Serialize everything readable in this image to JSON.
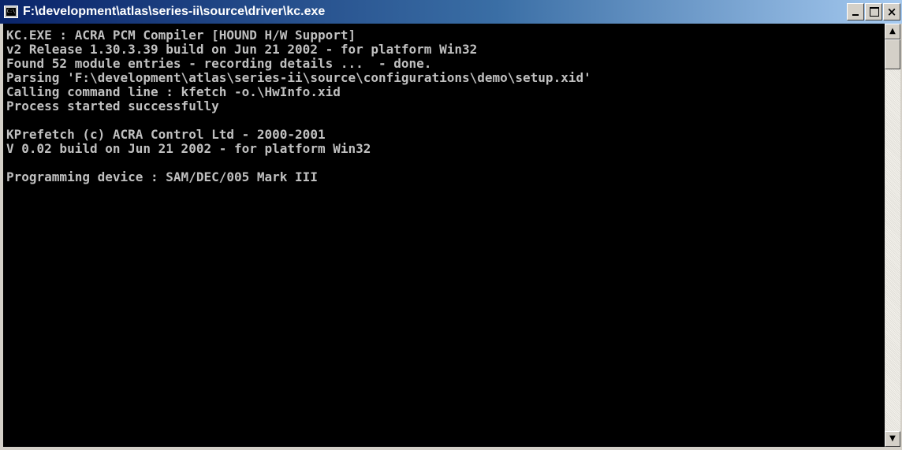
{
  "window": {
    "title": "F:\\development\\atlas\\series-ii\\source\\driver\\kc.exe",
    "icon": "console-app-icon",
    "icon_glyph": "C:\\",
    "buttons": {
      "minimize_icon": "minimize-icon",
      "maximize_icon": "maximize-icon",
      "close_icon": "close-icon",
      "close_glyph": "×"
    }
  },
  "console": {
    "background": "#000000",
    "text_color": "#c0c0c0",
    "lines": [
      "KC.EXE : ACRA PCM Compiler [HOUND H/W Support]",
      "v2 Release 1.30.3.39 build on Jun 21 2002 - for platform Win32",
      "Found 52 module entries - recording details ...  - done.",
      "Parsing 'F:\\development\\atlas\\series-ii\\source\\configurations\\demo\\setup.xid'",
      "Calling command line : kfetch -o.\\HwInfo.xid",
      "Process started successfully",
      "",
      "KPrefetch (c) ACRA Control Ltd - 2000-2001",
      "V 0.02 build on Jun 21 2002 - for platform Win32",
      "",
      "Programming device : SAM/DEC/005 Mark III"
    ]
  },
  "scrollbar": {
    "up_glyph": "▲",
    "down_glyph": "▼"
  }
}
